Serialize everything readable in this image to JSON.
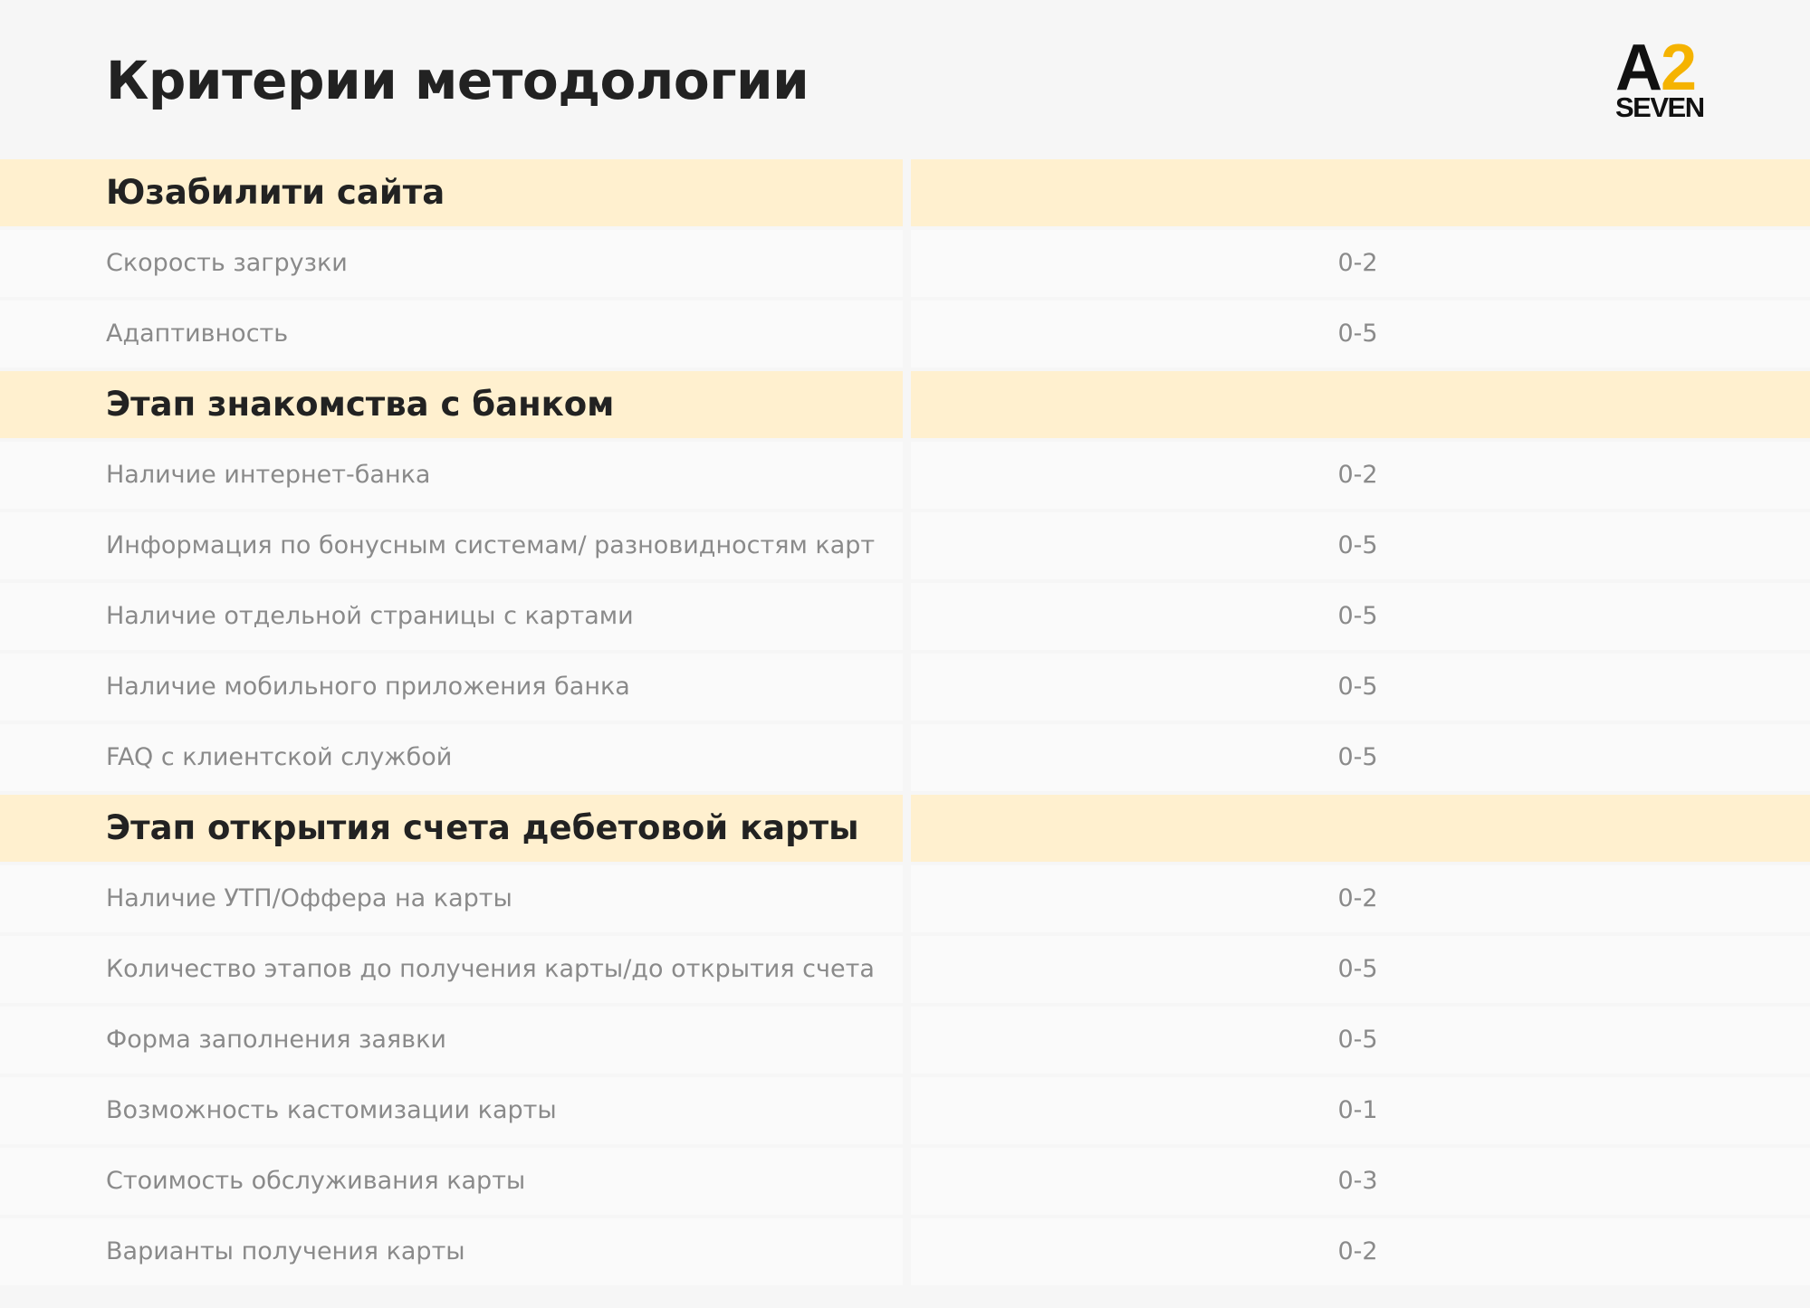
{
  "page": {
    "title": "Критерии методологии"
  },
  "logo": {
    "letter": "A",
    "digit": "2",
    "word": "SEVEN",
    "colors": {
      "dark": "#111111",
      "accent": "#f5b301"
    }
  },
  "colors": {
    "section_bg": "#fff0cf",
    "row_bg": "#fafafa",
    "page_bg": "#f6f6f6",
    "title_text": "#222222",
    "row_text": "#8a8a8a"
  },
  "rows": [
    {
      "type": "section",
      "label": "Юзабилити сайта"
    },
    {
      "type": "item",
      "label": "Скорость загрузки",
      "score": "0-2"
    },
    {
      "type": "item",
      "label": "Адаптивность",
      "score": "0-5"
    },
    {
      "type": "section",
      "label": "Этап знакомства с банком"
    },
    {
      "type": "item",
      "label": "Наличие интернет-банка",
      "score": "0-2"
    },
    {
      "type": "item",
      "label": "Информация по бонусным системам/ разновидностям карт",
      "score": "0-5"
    },
    {
      "type": "item",
      "label": "Наличие отдельной страницы с картами",
      "score": "0-5"
    },
    {
      "type": "item",
      "label": "Наличие мобильного приложения банка",
      "score": "0-5"
    },
    {
      "type": "item",
      "label": "FAQ с клиентской службой",
      "score": "0-5"
    },
    {
      "type": "section",
      "label": "Этап открытия счета дебетовой карты"
    },
    {
      "type": "item",
      "label": "Наличие УТП/Оффера на карты",
      "score": "0-2"
    },
    {
      "type": "item",
      "label": "Количество этапов до получения карты/до открытия счета",
      "score": "0-5"
    },
    {
      "type": "item",
      "label": "Форма заполнения заявки",
      "score": "0-5"
    },
    {
      "type": "item",
      "label": "Возможность кастомизации карты",
      "score": "0-1"
    },
    {
      "type": "item",
      "label": "Стоимость обслуживания карты",
      "score": "0-3"
    },
    {
      "type": "item",
      "label": "Варианты получения карты",
      "score": "0-2"
    }
  ]
}
